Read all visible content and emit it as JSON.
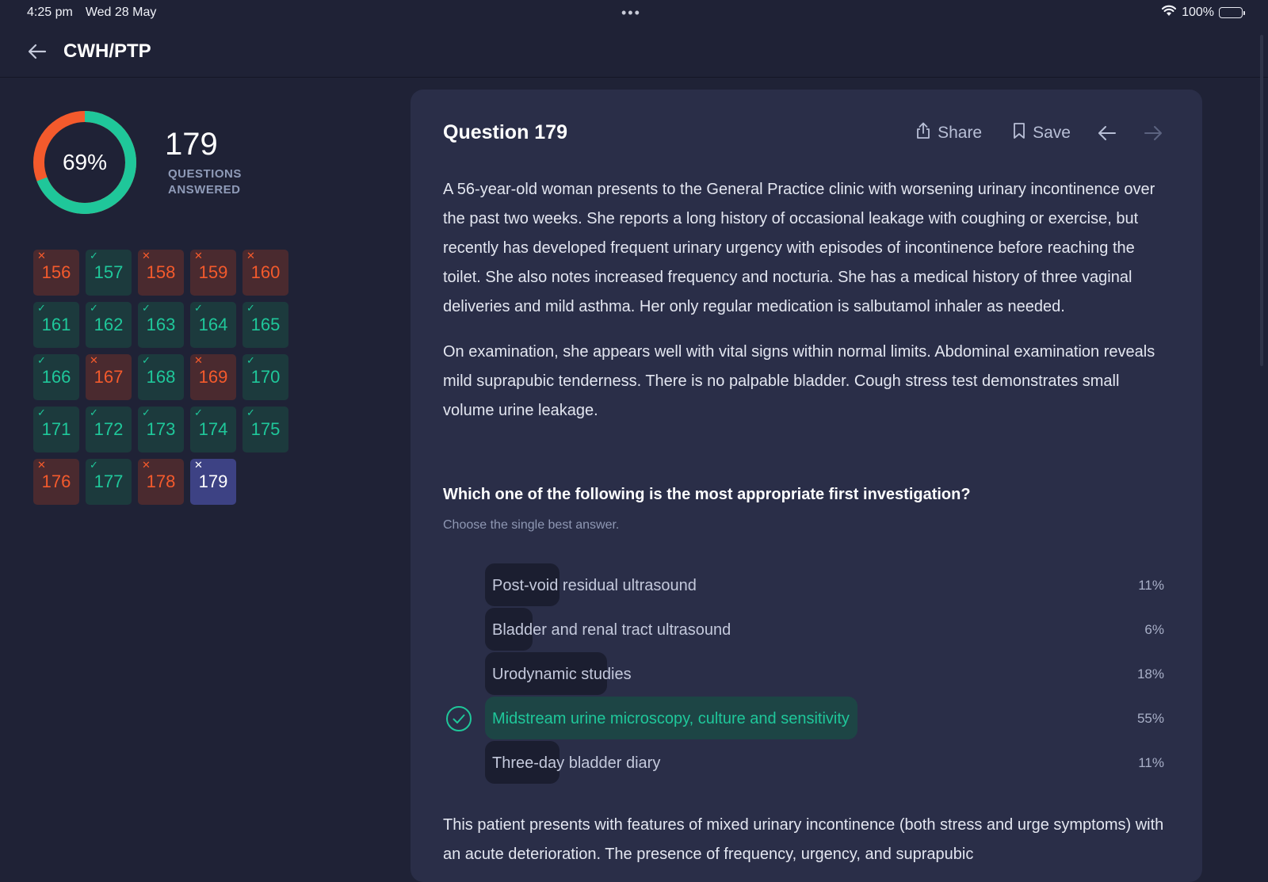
{
  "status_bar": {
    "time": "4:25 pm",
    "date": "Wed 28 May",
    "dots": "•••",
    "battery": "100%"
  },
  "header": {
    "title": "CWH/PTP"
  },
  "summary": {
    "percent_label": "69%",
    "percent_value": 69,
    "answered_count": "179",
    "answered_label_line1": "QUESTIONS",
    "answered_label_line2": "ANSWERED",
    "colors": {
      "correct": "#1fc79a",
      "wrong": "#f45a2c"
    }
  },
  "question_grid": [
    {
      "number": "156",
      "status": "wrong"
    },
    {
      "number": "157",
      "status": "correct"
    },
    {
      "number": "158",
      "status": "wrong"
    },
    {
      "number": "159",
      "status": "wrong"
    },
    {
      "number": "160",
      "status": "wrong"
    },
    {
      "number": "161",
      "status": "correct"
    },
    {
      "number": "162",
      "status": "correct"
    },
    {
      "number": "163",
      "status": "correct"
    },
    {
      "number": "164",
      "status": "correct"
    },
    {
      "number": "165",
      "status": "correct"
    },
    {
      "number": "166",
      "status": "correct"
    },
    {
      "number": "167",
      "status": "wrong"
    },
    {
      "number": "168",
      "status": "correct"
    },
    {
      "number": "169",
      "status": "wrong"
    },
    {
      "number": "170",
      "status": "correct"
    },
    {
      "number": "171",
      "status": "correct"
    },
    {
      "number": "172",
      "status": "correct"
    },
    {
      "number": "173",
      "status": "correct"
    },
    {
      "number": "174",
      "status": "correct"
    },
    {
      "number": "175",
      "status": "correct"
    },
    {
      "number": "176",
      "status": "wrong"
    },
    {
      "number": "177",
      "status": "correct"
    },
    {
      "number": "178",
      "status": "wrong"
    },
    {
      "number": "179",
      "status": "current"
    }
  ],
  "question": {
    "title": "Question 179",
    "share_label": "Share",
    "save_label": "Save",
    "stem_p1": "A 56-year-old woman presents to the General Practice clinic with worsening urinary incontinence over the past two weeks. She reports a long history of occasional leakage with coughing or exercise, but recently has developed frequent urinary urgency with episodes of incontinence before reaching the toilet. She also notes increased frequency and nocturia. She has a medical history of three vaginal deliveries and mild asthma. Her only regular medication is salbutamol inhaler as needed.",
    "stem_p2": "On examination, she appears well with vital signs within normal limits. Abdominal examination reveals mild suprapubic tenderness. There is no palpable bladder. Cough stress test demonstrates small volume urine leakage.",
    "prompt": "Which one of the following is the most appropriate first investigation?",
    "hint": "Choose the single best answer.",
    "options": [
      {
        "text": "Post-void residual ultrasound",
        "percent_label": "11%",
        "percent": 11,
        "correct": false
      },
      {
        "text": "Bladder and renal tract ultrasound",
        "percent_label": "6%",
        "percent": 6,
        "correct": false
      },
      {
        "text": "Urodynamic studies",
        "percent_label": "18%",
        "percent": 18,
        "correct": false
      },
      {
        "text": "Midstream urine microscopy, culture and sensitivity",
        "percent_label": "55%",
        "percent": 55,
        "correct": true
      },
      {
        "text": "Three-day bladder diary",
        "percent_label": "11%",
        "percent": 11,
        "correct": false
      }
    ],
    "explanation": "This patient presents with features of mixed urinary incontinence (both stress and urge symptoms) with an acute deterioration. The presence of frequency, urgency, and suprapubic"
  }
}
